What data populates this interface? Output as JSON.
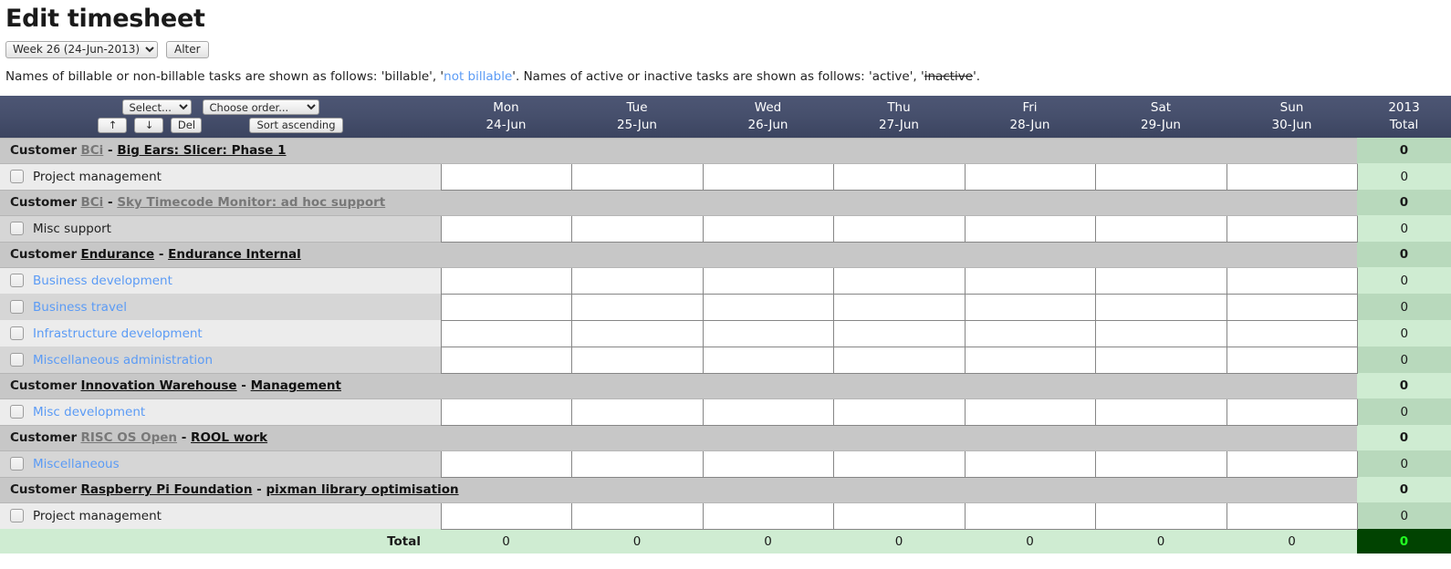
{
  "page": {
    "title": "Edit timesheet"
  },
  "week_selector": {
    "selected": "Week 26 (24-Jun-2013)",
    "options": [
      "Week 26 (24-Jun-2013)"
    ],
    "alter_label": "Alter"
  },
  "legend": {
    "part1": "Names of billable or non-billable tasks are shown as follows: 'billable', '",
    "notbillable": "not billable",
    "part2": "'. Names of active or inactive tasks are shown as follows: 'active', '",
    "inactive": "inactive",
    "part3": "'."
  },
  "toolbar": {
    "select_placeholder": "Select...",
    "order_placeholder": "Choose order...",
    "up_label": "↑",
    "down_label": "↓",
    "del_label": "Del",
    "sort_label": "Sort ascending"
  },
  "columns": [
    {
      "day": "Mon",
      "date": "24-Jun"
    },
    {
      "day": "Tue",
      "date": "25-Jun"
    },
    {
      "day": "Wed",
      "date": "26-Jun"
    },
    {
      "day": "Thu",
      "date": "27-Jun"
    },
    {
      "day": "Fri",
      "date": "28-Jun"
    },
    {
      "day": "Sat",
      "date": "29-Jun"
    },
    {
      "day": "Sun",
      "date": "30-Jun"
    }
  ],
  "total_header": {
    "year": "2013",
    "label": "Total"
  },
  "groups": [
    {
      "customer_label": "Customer",
      "customer": "BCi",
      "customer_state": "inactive",
      "project": "Big Ears: Slicer: Phase 1",
      "project_state": "active",
      "total": "0",
      "tasks": [
        {
          "name": "Project management",
          "billing": "billable",
          "values": [
            "",
            "",
            "",
            "",
            "",
            "",
            ""
          ],
          "total": "0"
        }
      ]
    },
    {
      "customer_label": "Customer",
      "customer": "BCi",
      "customer_state": "inactive",
      "project": "Sky Timecode Monitor: ad hoc support",
      "project_state": "inactive",
      "total": "0",
      "tasks": [
        {
          "name": "Misc support",
          "billing": "billable",
          "values": [
            "",
            "",
            "",
            "",
            "",
            "",
            ""
          ],
          "total": "0"
        }
      ]
    },
    {
      "customer_label": "Customer",
      "customer": "Endurance",
      "customer_state": "active",
      "project": "Endurance Internal",
      "project_state": "active",
      "total": "0",
      "tasks": [
        {
          "name": "Business development",
          "billing": "not billable",
          "values": [
            "",
            "",
            "",
            "",
            "",
            "",
            ""
          ],
          "total": "0"
        },
        {
          "name": "Business travel",
          "billing": "not billable",
          "values": [
            "",
            "",
            "",
            "",
            "",
            "",
            ""
          ],
          "total": "0"
        },
        {
          "name": "Infrastructure development",
          "billing": "not billable",
          "values": [
            "",
            "",
            "",
            "",
            "",
            "",
            ""
          ],
          "total": "0"
        },
        {
          "name": "Miscellaneous administration",
          "billing": "not billable",
          "values": [
            "",
            "",
            "",
            "",
            "",
            "",
            ""
          ],
          "total": "0"
        }
      ]
    },
    {
      "customer_label": "Customer",
      "customer": "Innovation Warehouse",
      "customer_state": "active",
      "project": "Management",
      "project_state": "active",
      "total": "0",
      "tasks": [
        {
          "name": "Misc development",
          "billing": "not billable",
          "values": [
            "",
            "",
            "",
            "",
            "",
            "",
            ""
          ],
          "total": "0"
        }
      ]
    },
    {
      "customer_label": "Customer",
      "customer": "RISC OS Open",
      "customer_state": "inactive",
      "project": "ROOL work",
      "project_state": "active",
      "total": "0",
      "tasks": [
        {
          "name": "Miscellaneous",
          "billing": "not billable",
          "values": [
            "",
            "",
            "",
            "",
            "",
            "",
            ""
          ],
          "total": "0"
        }
      ]
    },
    {
      "customer_label": "Customer",
      "customer": "Raspberry Pi Foundation",
      "customer_state": "active",
      "project": "pixman library optimisation",
      "project_state": "active",
      "total": "0",
      "tasks": [
        {
          "name": "Project management",
          "billing": "billable",
          "values": [
            "",
            "",
            "",
            "",
            "",
            "",
            ""
          ],
          "total": "0"
        }
      ]
    }
  ],
  "footer": {
    "label": "Total",
    "day_totals": [
      "0",
      "0",
      "0",
      "0",
      "0",
      "0",
      "0"
    ],
    "grand_total": "0"
  },
  "colors": {
    "header_top": "#4d5674",
    "header_bottom": "#3b4460",
    "group_row": "#c7c7c7",
    "task_row_light": "#ececec",
    "task_row_dark": "#d6d6d6",
    "total_dark": "#b8d9bc",
    "total_light": "#cfecd2",
    "grand_total_bg": "#014301",
    "grand_total_fg": "#22ff22",
    "notbillable_text": "#5b9bf5"
  }
}
